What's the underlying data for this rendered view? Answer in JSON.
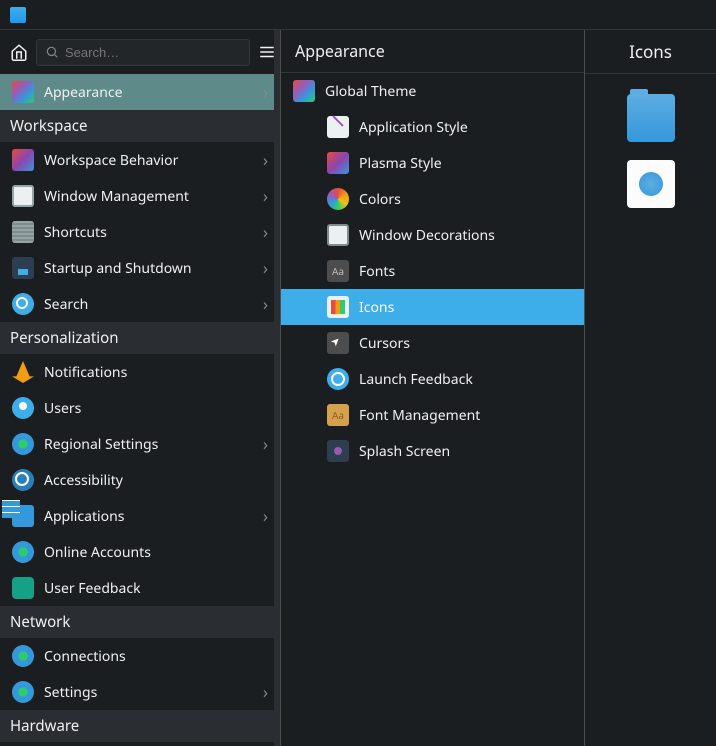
{
  "titlebar": {
    "title": ""
  },
  "header": {
    "search_placeholder": "Search…"
  },
  "sidebar": {
    "items": [
      {
        "label": "Appearance",
        "icon": "ic-appearance",
        "name": "sidebar-item-appearance",
        "chevron": true,
        "selected": true
      }
    ],
    "sections": [
      {
        "title": "Workspace",
        "items": [
          {
            "label": "Workspace Behavior",
            "icon": "ic-workspace-behavior",
            "name": "sidebar-item-workspace-behavior",
            "chevron": true
          },
          {
            "label": "Window Management",
            "icon": "ic-window-mgmt",
            "name": "sidebar-item-window-management",
            "chevron": true
          },
          {
            "label": "Shortcuts",
            "icon": "ic-shortcuts",
            "name": "sidebar-item-shortcuts",
            "chevron": true
          },
          {
            "label": "Startup and Shutdown",
            "icon": "ic-startup",
            "name": "sidebar-item-startup-shutdown",
            "chevron": true
          },
          {
            "label": "Search",
            "icon": "ic-search",
            "name": "sidebar-item-search",
            "chevron": true
          }
        ]
      },
      {
        "title": "Personalization",
        "items": [
          {
            "label": "Notifications",
            "icon": "ic-notifications",
            "name": "sidebar-item-notifications",
            "chevron": false
          },
          {
            "label": "Users",
            "icon": "ic-users",
            "name": "sidebar-item-users",
            "chevron": false
          },
          {
            "label": "Regional Settings",
            "icon": "ic-regional",
            "name": "sidebar-item-regional-settings",
            "chevron": true
          },
          {
            "label": "Accessibility",
            "icon": "ic-accessibility",
            "name": "sidebar-item-accessibility",
            "chevron": false
          },
          {
            "label": "Applications",
            "icon": "ic-applications",
            "name": "sidebar-item-applications",
            "chevron": true
          },
          {
            "label": "Online Accounts",
            "icon": "ic-online-accounts",
            "name": "sidebar-item-online-accounts",
            "chevron": false
          },
          {
            "label": "User Feedback",
            "icon": "ic-user-feedback",
            "name": "sidebar-item-user-feedback",
            "chevron": false
          }
        ]
      },
      {
        "title": "Network",
        "items": [
          {
            "label": "Connections",
            "icon": "ic-connections",
            "name": "sidebar-item-connections",
            "chevron": false
          },
          {
            "label": "Settings",
            "icon": "ic-settings",
            "name": "sidebar-item-settings",
            "chevron": true
          }
        ]
      },
      {
        "title": "Hardware",
        "items": []
      }
    ]
  },
  "middle": {
    "title": "Appearance",
    "items": [
      {
        "label": "Global Theme",
        "icon": "ic-global-theme",
        "name": "middle-item-global-theme",
        "indent": false,
        "selected": false
      },
      {
        "label": "Application Style",
        "icon": "ic-app-style",
        "name": "middle-item-application-style",
        "indent": true,
        "selected": false
      },
      {
        "label": "Plasma Style",
        "icon": "ic-plasma-style",
        "name": "middle-item-plasma-style",
        "indent": true,
        "selected": false
      },
      {
        "label": "Colors",
        "icon": "ic-colors",
        "name": "middle-item-colors",
        "indent": true,
        "selected": false
      },
      {
        "label": "Window Decorations",
        "icon": "ic-window-deco",
        "name": "middle-item-window-decorations",
        "indent": true,
        "selected": false
      },
      {
        "label": "Fonts",
        "icon": "ic-fonts",
        "name": "middle-item-fonts",
        "indent": true,
        "selected": false
      },
      {
        "label": "Icons",
        "icon": "ic-icons",
        "name": "middle-item-icons",
        "indent": true,
        "selected": true
      },
      {
        "label": "Cursors",
        "icon": "ic-cursors",
        "name": "middle-item-cursors",
        "indent": true,
        "selected": false
      },
      {
        "label": "Launch Feedback",
        "icon": "ic-launch",
        "name": "middle-item-launch-feedback",
        "indent": true,
        "selected": false
      },
      {
        "label": "Font Management",
        "icon": "ic-font-mgmt",
        "name": "middle-item-font-management",
        "indent": true,
        "selected": false
      },
      {
        "label": "Splash Screen",
        "icon": "ic-splash",
        "name": "middle-item-splash-screen",
        "indent": true,
        "selected": false
      }
    ]
  },
  "right": {
    "title": "Icons"
  }
}
